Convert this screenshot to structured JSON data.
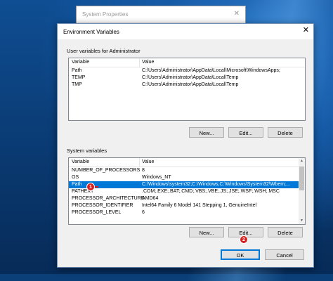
{
  "system_properties": {
    "title": "System Properties",
    "close": "✕"
  },
  "dialog": {
    "title": "Environment Variables",
    "close": "✕",
    "user_group_label": "User variables for Administrator",
    "system_group_label": "System variables",
    "col_variable": "Variable",
    "col_value": "Value",
    "user_vars": [
      {
        "name": "Path",
        "value": "C:\\Users\\Administrator\\AppData\\Local\\Microsoft\\WindowsApps;"
      },
      {
        "name": "TEMP",
        "value": "C:\\Users\\Administrator\\AppData\\Local\\Temp"
      },
      {
        "name": "TMP",
        "value": "C:\\Users\\Administrator\\AppData\\Local\\Temp"
      }
    ],
    "system_vars": [
      {
        "name": "NUMBER_OF_PROCESSORS",
        "value": "8"
      },
      {
        "name": "OS",
        "value": "Windows_NT"
      },
      {
        "name": "Path",
        "value": "C:\\Windows\\system32;C:\\Windows;C:\\Windows\\System32\\Wbem;..."
      },
      {
        "name": "PATHEXT",
        "value": ".COM;.EXE;.BAT;.CMD;.VBS;.VBE;.JS;.JSE;.WSF;.WSH;.MSC"
      },
      {
        "name": "PROCESSOR_ARCHITECTURE",
        "value": "AMD64"
      },
      {
        "name": "PROCESSOR_IDENTIFIER",
        "value": "Intel64 Family 6 Model 141 Stepping 1, GenuineIntel"
      },
      {
        "name": "PROCESSOR_LEVEL",
        "value": "6"
      }
    ],
    "selected_system_var": "Path",
    "buttons": {
      "new": "New...",
      "edit": "Edit...",
      "delete": "Delete",
      "ok": "OK",
      "cancel": "Cancel"
    }
  },
  "annotations": {
    "step1": "1",
    "step2": "2",
    "color": "#d6201f"
  },
  "colors": {
    "selection": "#0078d7",
    "dialog_bg": "#f0f0f0"
  }
}
